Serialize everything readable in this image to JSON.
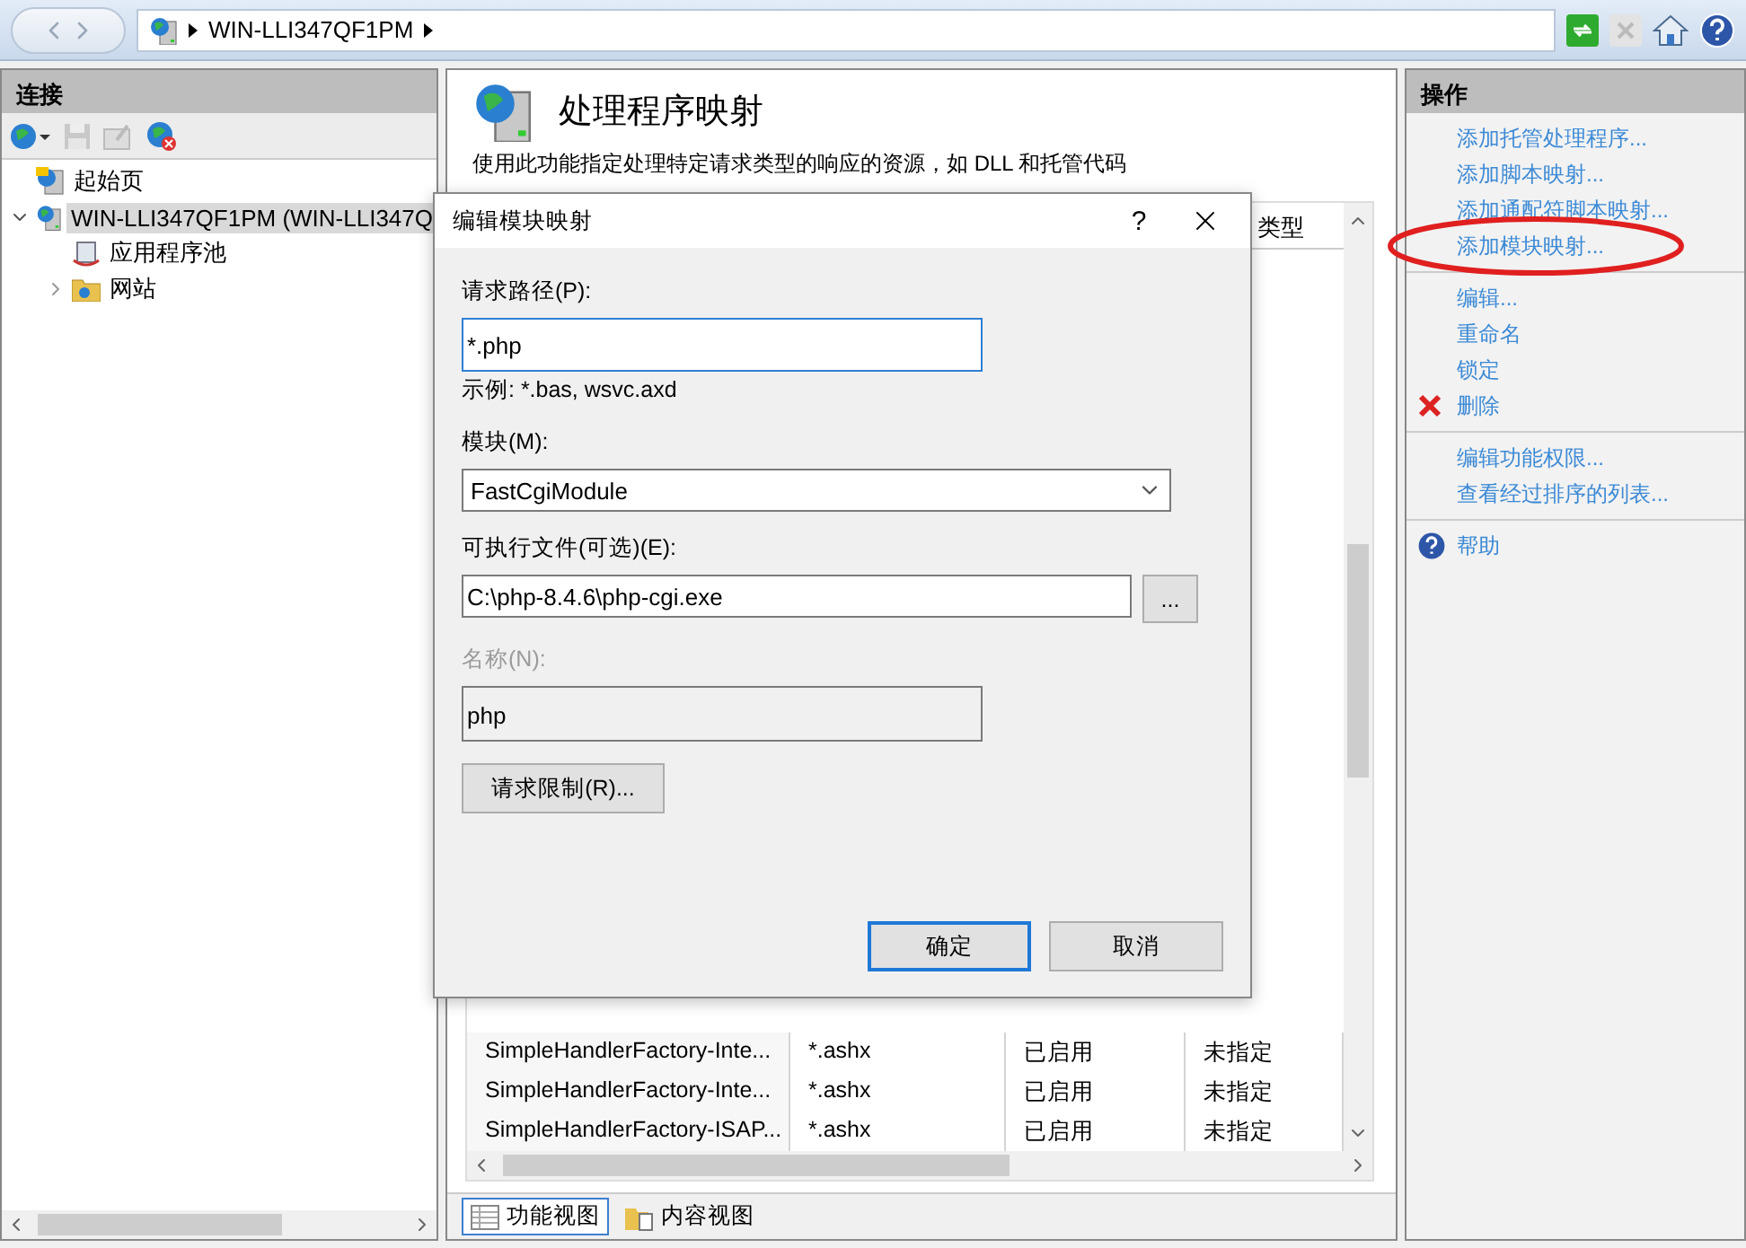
{
  "address_bar": {
    "segments": [
      "WIN-LLI347QF1PM"
    ]
  },
  "connections": {
    "title": "连接",
    "tree": [
      {
        "label": "起始页",
        "selected": false
      },
      {
        "label": "WIN-LLI347QF1PM (WIN-LLI347Q",
        "selected": true,
        "expanded": true,
        "children": [
          {
            "label": "应用程序池",
            "selected": false
          },
          {
            "label": "网站",
            "selected": false,
            "expanded": false
          }
        ]
      }
    ]
  },
  "feature": {
    "title": "处理程序映射",
    "description": "使用此功能指定处理特定请求类型的响应的资源，如 DLL 和托管代码",
    "table": {
      "column_4": "类型",
      "rows": [
        {
          "cells": [
            "SimpleHandlerFactory-Inte...",
            "*.ashx",
            "已启用",
            "未指定"
          ],
          "selected": false
        },
        {
          "cells": [
            "SimpleHandlerFactory-Inte...",
            "*.ashx",
            "已启用",
            "未指定"
          ],
          "selected": false
        },
        {
          "cells": [
            "SimpleHandlerFactory-ISAP...",
            "*.ashx",
            "已启用",
            "未指定"
          ],
          "selected": false
        }
      ]
    },
    "view_tabs": [
      {
        "label": "功能视图",
        "selected": true
      },
      {
        "label": "内容视图",
        "selected": false
      }
    ]
  },
  "actions": {
    "title": "操作",
    "groups": [
      [
        {
          "kind": "link",
          "label": "添加托管处理程序..."
        },
        {
          "kind": "link",
          "label": "添加脚本映射..."
        },
        {
          "kind": "link",
          "label": "添加通配符脚本映射..."
        },
        {
          "kind": "link",
          "label": "添加模块映射...",
          "circled": true
        }
      ],
      [
        {
          "kind": "link",
          "label": "编辑..."
        },
        {
          "kind": "link",
          "label": "重命名"
        },
        {
          "kind": "link",
          "label": "锁定"
        },
        {
          "kind": "delete",
          "label": "删除"
        }
      ],
      [
        {
          "kind": "link",
          "label": "编辑功能权限..."
        },
        {
          "kind": "link",
          "label": "查看经过排序的列表..."
        }
      ],
      [
        {
          "kind": "help",
          "label": "帮助"
        }
      ]
    ]
  },
  "dialog": {
    "title": "编辑模块映射",
    "help": "?",
    "fields": [
      {
        "kind": "text",
        "label": "请求路径(P):",
        "value": "*.php",
        "focused": true,
        "hint": "示例: *.bas, wsvc.axd"
      },
      {
        "kind": "select",
        "label": "模块(M):",
        "value": "FastCgiModule"
      },
      {
        "kind": "file",
        "label": "可执行文件(可选)(E):",
        "value": "C:\\php-8.4.6\\php-cgi.exe",
        "browse": "..."
      },
      {
        "kind": "text",
        "label": "名称(N):",
        "value": "php",
        "disabled": true
      }
    ],
    "restrictions_button": "请求限制(R)...",
    "buttons": [
      {
        "label": "确定",
        "default": true
      },
      {
        "label": "取消",
        "default": false
      }
    ]
  }
}
